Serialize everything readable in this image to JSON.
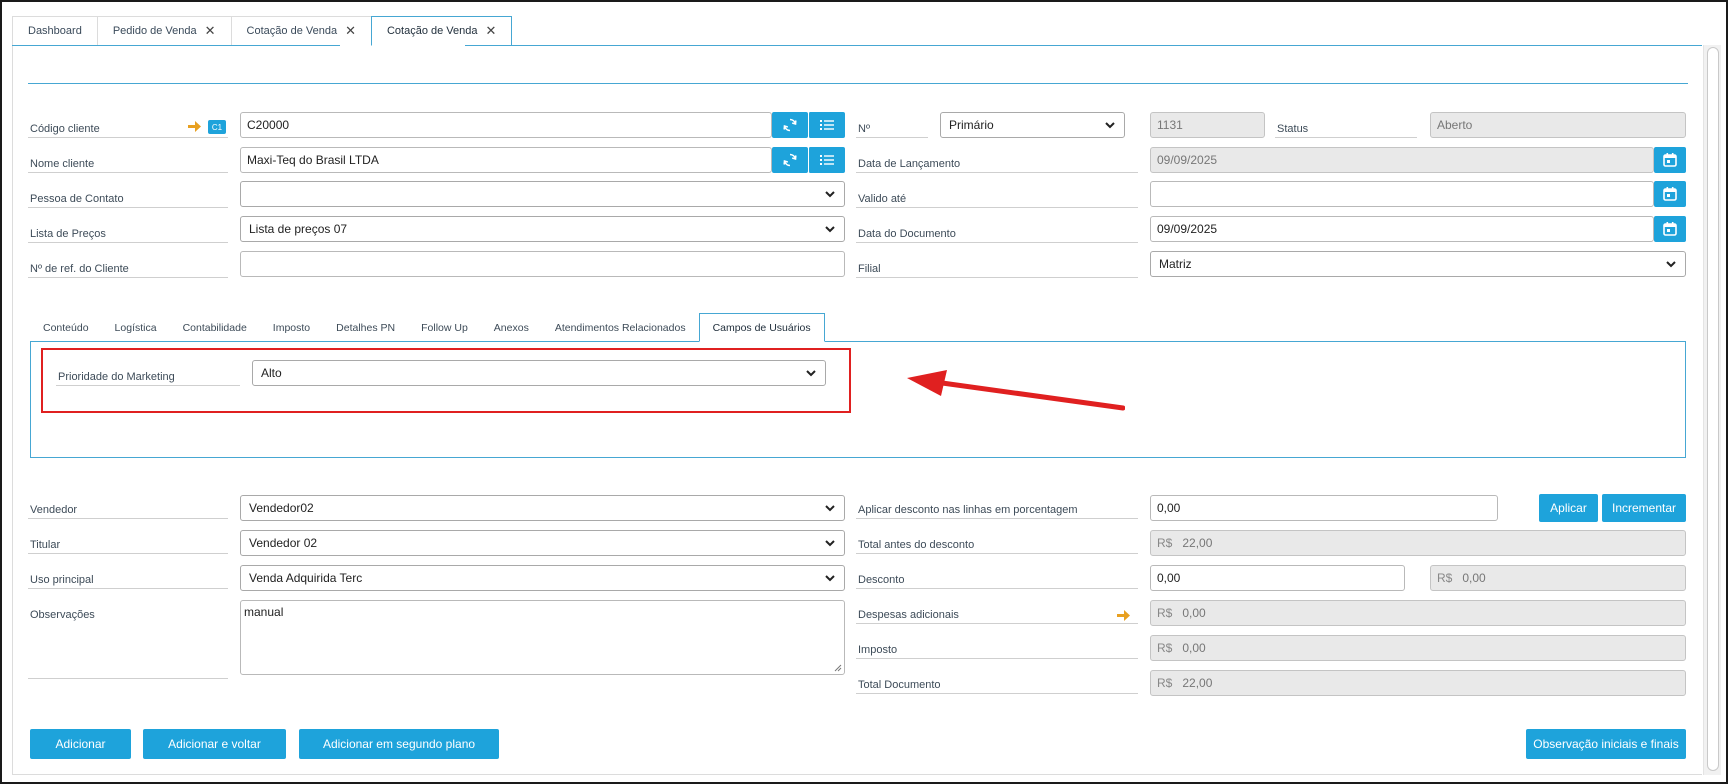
{
  "tabs": [
    {
      "label": "Dashboard",
      "closable": false,
      "active": false
    },
    {
      "label": "Pedido de Venda",
      "closable": true,
      "active": false
    },
    {
      "label": "Cotação de Venda",
      "closable": true,
      "active": false
    },
    {
      "label": "Cotação de Venda",
      "closable": true,
      "active": true
    }
  ],
  "header": {
    "codigo_cliente_label": "Código cliente",
    "codigo_badge": "C1",
    "codigo_cliente_value": "C20000",
    "nome_cliente_label": "Nome cliente",
    "nome_cliente_value": "Maxi-Teq do Brasil LTDA",
    "pessoa_contato_label": "Pessoa de Contato",
    "pessoa_contato_value": "",
    "lista_precos_label": "Lista de Preços",
    "lista_precos_value": "Lista de preços 07",
    "ref_cliente_label": "Nº de ref. do Cliente",
    "ref_cliente_value": "",
    "numero_label": "Nº",
    "numero_series": "Primário",
    "numero_value": "1131",
    "status_label": "Status",
    "status_value": "Aberto",
    "data_lancamento_label": "Data de Lançamento",
    "data_lancamento_value": "09/09/2025",
    "valido_ate_label": "Valido até",
    "valido_ate_value": "",
    "data_documento_label": "Data do Documento",
    "data_documento_value": "09/09/2025",
    "filial_label": "Filial",
    "filial_value": "Matriz"
  },
  "inner_tabs": [
    {
      "label": "Conteúdo",
      "active": false
    },
    {
      "label": "Logística",
      "active": false
    },
    {
      "label": "Contabilidade",
      "active": false
    },
    {
      "label": "Imposto",
      "active": false
    },
    {
      "label": "Detalhes PN",
      "active": false
    },
    {
      "label": "Follow Up",
      "active": false
    },
    {
      "label": "Anexos",
      "active": false
    },
    {
      "label": "Atendimentos Relacionados",
      "active": false
    },
    {
      "label": "Campos de Usuários",
      "active": true
    }
  ],
  "user_fields": {
    "prioridade_label": "Prioridade do Marketing",
    "prioridade_value": "Alto"
  },
  "footer": {
    "vendedor_label": "Vendedor",
    "vendedor_value": "Vendedor02",
    "titular_label": "Titular",
    "titular_value": "Vendedor 02",
    "uso_label": "Uso principal",
    "uso_value": "Venda Adquirida Terc",
    "observacoes_label": "Observações",
    "observacoes_value": "manual",
    "desconto_linhas_label": "Aplicar desconto nas linhas em porcentagem",
    "desconto_linhas_value": "0,00",
    "aplicar_label": "Aplicar",
    "incrementar_label": "Incrementar",
    "total_antes_label": "Total antes do desconto",
    "currency": "R$",
    "total_antes_value": "22,00",
    "desconto_label": "Desconto",
    "desconto_pct_value": "0,00",
    "desconto_amount_value": "0,00",
    "despesas_label": "Despesas adicionais",
    "despesas_value": "0,00",
    "imposto_label": "Imposto",
    "imposto_value": "0,00",
    "total_doc_label": "Total Documento",
    "total_doc_value": "22,00"
  },
  "actions": {
    "adicionar": "Adicionar",
    "adicionar_voltar": "Adicionar e voltar",
    "adicionar_segundo_plano": "Adicionar em segundo plano",
    "observacao": "Observação iniciais e finais"
  },
  "colors": {
    "accent": "#1ea3db",
    "tab_border": "#46a7d3",
    "highlight": "#e02020",
    "arrow": "#e8a020"
  }
}
